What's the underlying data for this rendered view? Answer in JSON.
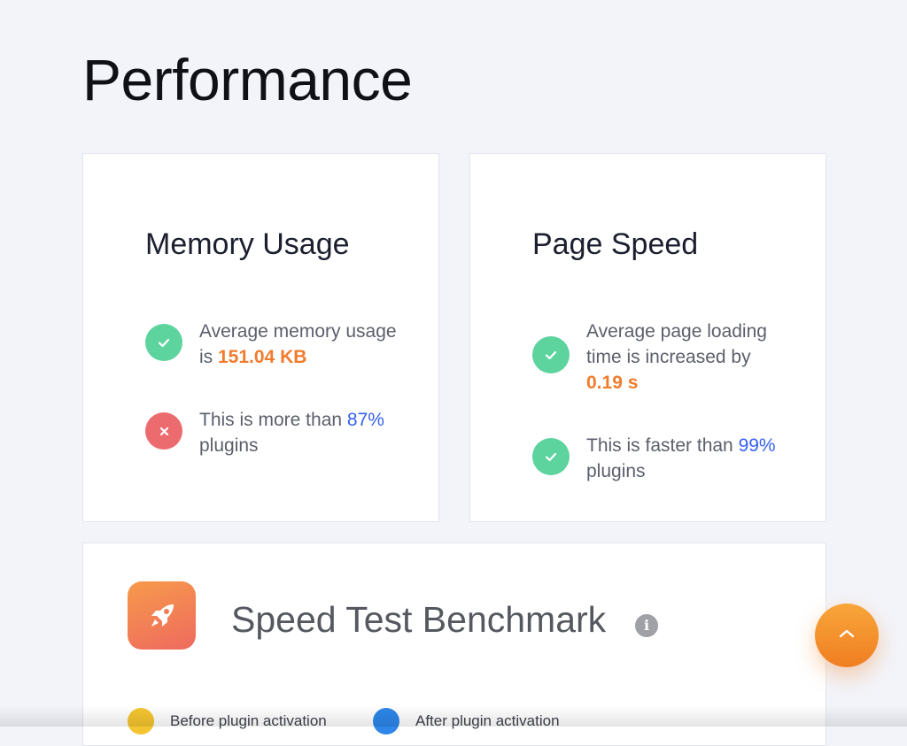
{
  "page": {
    "title": "Performance"
  },
  "memory": {
    "title": "Memory Usage",
    "stats": [
      {
        "status": "ok",
        "icon": "check-icon",
        "prefix": "Average memory usage is ",
        "value": "151.04 KB",
        "suffix": ""
      },
      {
        "status": "bad",
        "icon": "x-icon",
        "prefix": "This is more than ",
        "value": "87%",
        "suffix": " plugins"
      }
    ]
  },
  "speed": {
    "title": "Page Speed",
    "stats": [
      {
        "status": "ok",
        "icon": "check-icon",
        "prefix": "Average page loading time is increased by ",
        "value": "0.19 s",
        "suffix": ""
      },
      {
        "status": "ok",
        "icon": "check-icon",
        "prefix": "This is faster than ",
        "value": "99%",
        "suffix": " plugins"
      }
    ]
  },
  "benchmark": {
    "title": "Speed Test Benchmark",
    "info_icon": "i",
    "legend": [
      {
        "label": "Before plugin activation",
        "color": "#f4c530"
      },
      {
        "label": "After plugin activation",
        "color": "#2d86e8"
      }
    ]
  },
  "scroll_top": {
    "icon": "chevron-up-icon"
  },
  "colors": {
    "success": "#5dd39e",
    "danger": "#ec6b6e",
    "highlight_orange": "#f07c2d",
    "highlight_blue": "#3561f0",
    "accent": "#f08a2c",
    "background": "#f3f4f9"
  }
}
